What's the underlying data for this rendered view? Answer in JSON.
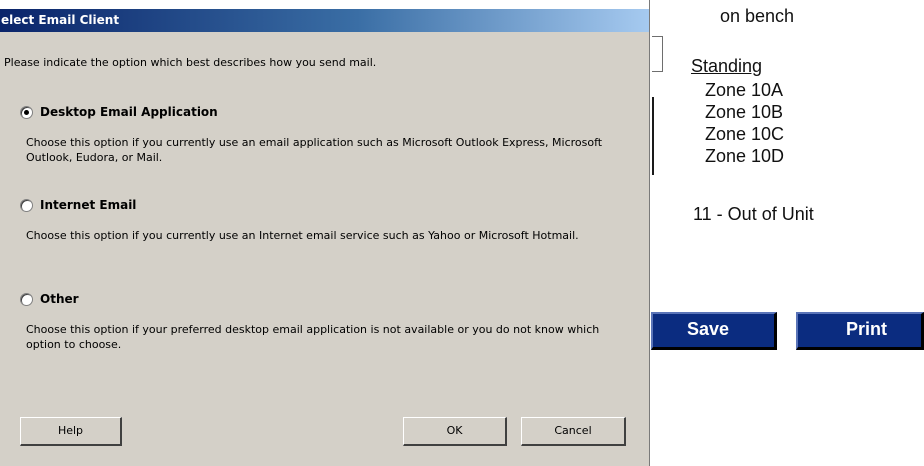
{
  "background_page": {
    "on_bench_text": "on bench",
    "standing_heading": "Standing",
    "zones": [
      "Zone 10A",
      "Zone 10B",
      "Zone 10C",
      "Zone 10D"
    ],
    "out_of_unit_text": "11 - Out of Unit",
    "save_label": "Save",
    "print_label": "Print",
    "button_color": "#0b2c80"
  },
  "dialog": {
    "title": "elect Email Client",
    "instruction": "Please indicate the option which best describes how you send mail.",
    "options": [
      {
        "label": "Desktop Email Application",
        "description": "Choose this option if you currently use an email application such as Microsoft Outlook Express, Microsoft Outlook, Eudora, or Mail.",
        "selected": true
      },
      {
        "label": "Internet Email",
        "description": "Choose this option if you currently use an Internet email service such as Yahoo or Microsoft Hotmail.",
        "selected": false
      },
      {
        "label": "Other",
        "description": "Choose this option if your preferred desktop email application is not available or you do not know which option to choose.",
        "selected": false
      }
    ],
    "help_label": "Help",
    "ok_label": "OK",
    "cancel_label": "Cancel",
    "titlebar_color": "#0a246a",
    "face_color": "#d4d0c8"
  }
}
